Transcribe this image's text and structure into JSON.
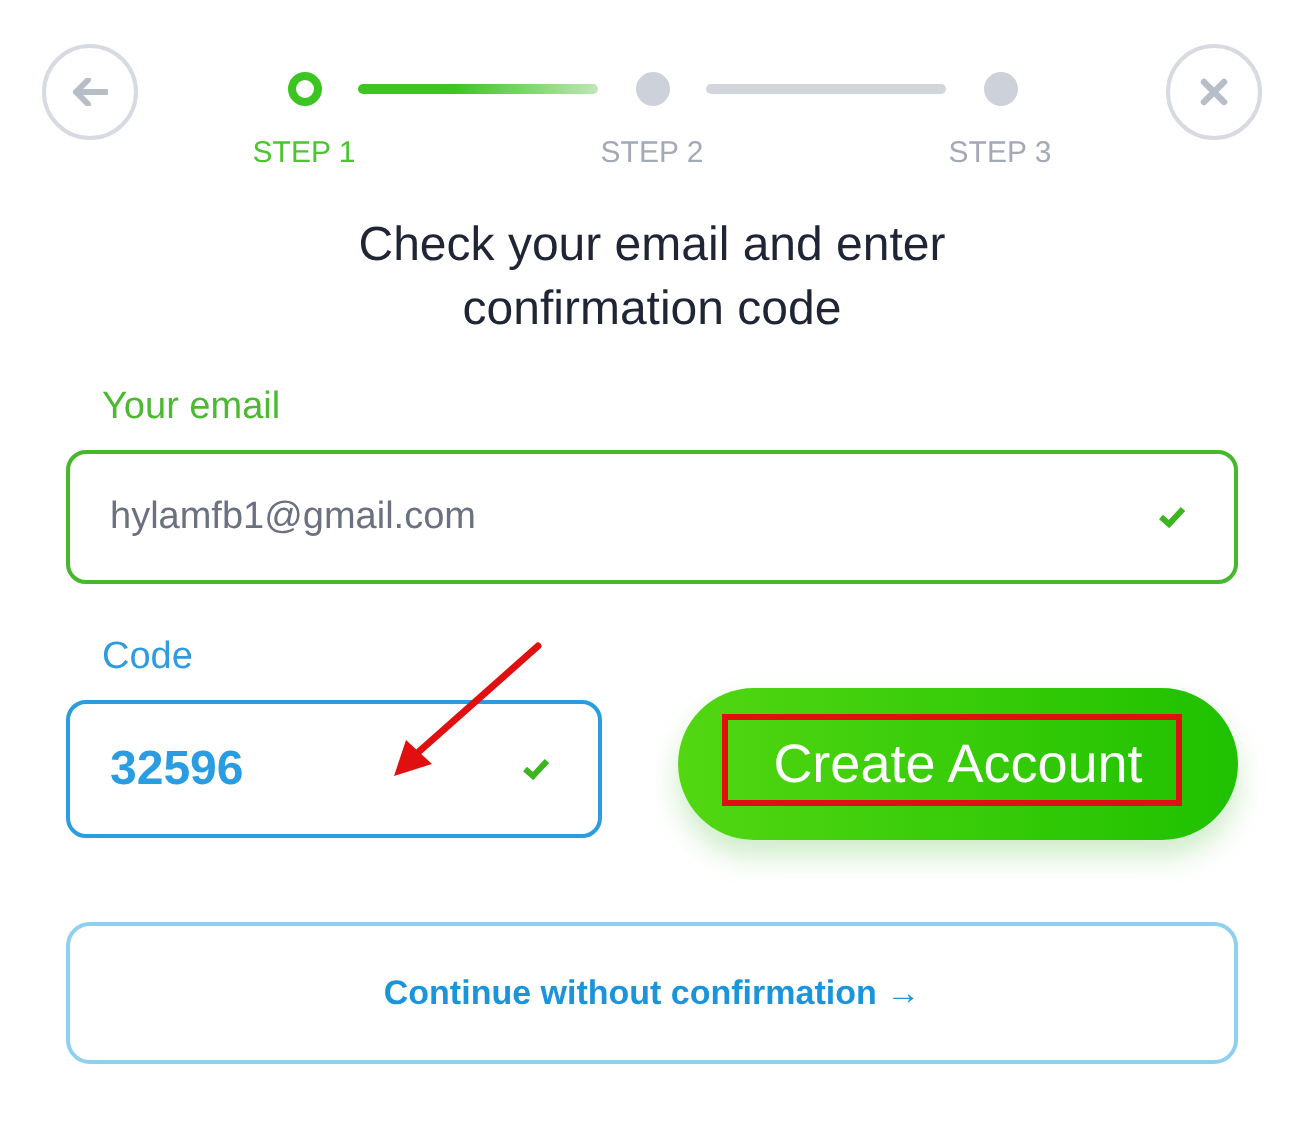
{
  "steps": [
    {
      "label": "STEP 1",
      "selected": true
    },
    {
      "label": "STEP 2",
      "selected": false
    },
    {
      "label": "STEP 3",
      "selected": false
    }
  ],
  "heading": "Check your email and enter confirmation code",
  "email": {
    "label": "Your email",
    "value": "hylamfb1@gmail.com",
    "valid": true
  },
  "code": {
    "label": "Code",
    "value": "32596",
    "valid": true
  },
  "create_button": "Create Account",
  "continue_link": "Continue without confirmation →"
}
